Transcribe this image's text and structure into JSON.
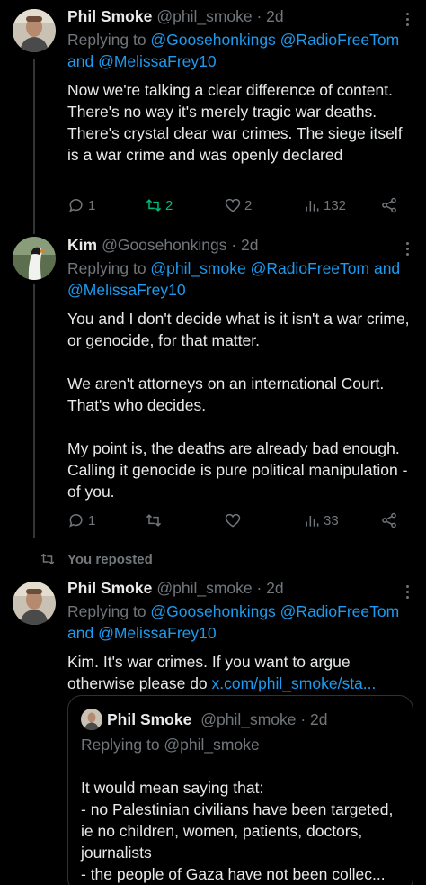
{
  "tweet1": {
    "name": "Phil Smoke",
    "handle_time": "@phil_smoke · 2d",
    "replying_prefix": "Replying to ",
    "replying_links_line1": "@Goosehonkings @RadioFreeTom",
    "replying_and": "and ",
    "replying_links_line2": "@MelissaFrey10",
    "text": "Now we're talking a clear difference of content. There's no way it's merely tragic war deaths. There's crystal clear war crimes. The siege itself is a war crime and was openly declared",
    "replies": "1",
    "reposts": "2",
    "likes": "2",
    "views": "132"
  },
  "tweet2": {
    "name": "Kim",
    "handle_time": "@Goosehonkings · 2d",
    "replying_prefix": "Replying to ",
    "replying_links_line1": "@phil_smoke @RadioFreeTom",
    "replying_and": " and",
    "replying_links_line2": "@MelissaFrey10",
    "text": "You and I don't decide what is it isn't a war crime, or genocide, for that matter.\n\nWe aren't attorneys on an international Court. That's who decides.\n\nMy point is, the deaths are already bad enough. Calling it genocide is pure political manipulation - of you.",
    "replies": "1",
    "reposts": "",
    "likes": "",
    "views": "33"
  },
  "repost_label": "You reposted",
  "tweet3": {
    "name": "Phil Smoke",
    "handle_time": "@phil_smoke · 2d",
    "replying_prefix": "Replying to ",
    "replying_links_line1": "@Goosehonkings @RadioFreeTom",
    "replying_and": "and ",
    "replying_links_line2": "@MelissaFrey10",
    "text": "Kim. It's war crimes. If you want to argue otherwise please do ",
    "link_text": "x.com/phil_smoke/sta..."
  },
  "quote": {
    "name": "Phil Smoke",
    "handle_time": "@phil_smoke · 2d",
    "replying_prefix": "Replying to ",
    "replying_link": "@phil_smoke",
    "text": "It would mean saying that:\n- no Palestinian civilians have been targeted, ie no children, women, patients, doctors, journalists\n- the people of Gaza have not been collec..."
  },
  "colors": {
    "background": "#000000",
    "text": "#e7e9ea",
    "muted": "#71767b",
    "link": "#1d9bf0",
    "repost_green": "#00ba7c"
  }
}
